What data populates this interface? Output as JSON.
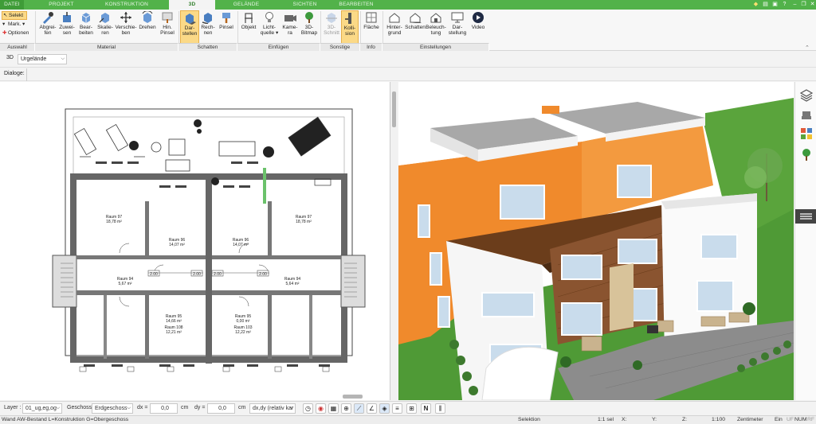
{
  "tabs": [
    "DATEI",
    "PROJEKT",
    "KONSTRUKTION",
    "3D",
    "GELÄNDE",
    "SICHTEN",
    "BEARBEITEN"
  ],
  "ribbon": {
    "auswahl": {
      "select": "Selekt",
      "mark": "Mark.",
      "options": "Optionen"
    },
    "material": [
      [
        "Abgrei-",
        "fen"
      ],
      [
        "Zuwei-",
        "sen"
      ],
      [
        "Bear-",
        "beiten"
      ],
      [
        "Skalie-",
        "ren"
      ],
      [
        "Verschie-",
        "ben"
      ],
      [
        "Drehen",
        ""
      ],
      [
        "Hin.",
        "Pinsel"
      ]
    ],
    "schatten": [
      [
        "Dar-",
        "stellen"
      ],
      [
        "Rech-",
        "nen"
      ],
      [
        "Pinsel",
        ""
      ]
    ],
    "einfuegen": [
      [
        "Objekt",
        ""
      ],
      [
        "Licht-",
        "quelle"
      ],
      [
        "Kame-",
        "ra"
      ],
      [
        "3D-",
        "Bitmap"
      ]
    ],
    "sonstige": [
      [
        "3D-",
        "Schnitt"
      ],
      [
        "Kolli-",
        "sion"
      ]
    ],
    "info": [
      [
        "Fläche",
        ""
      ]
    ],
    "einstellungen": [
      [
        "Hinter-",
        "grund"
      ],
      [
        "Schatten",
        ""
      ],
      [
        "Beleuch-",
        "tung"
      ],
      [
        "Dar-",
        "stellung"
      ],
      [
        "Video",
        ""
      ]
    ]
  },
  "groups": [
    "Auswahl",
    "Material",
    "Schatten",
    "Einfügen",
    "Sonstige",
    "Info",
    "Einstellungen"
  ],
  "toolbar": {
    "view_label": "3D",
    "terrain_select": "Urgelände",
    "dialogs_label": "Dialoge:"
  },
  "plan": {
    "rooms": [
      {
        "name": "Raum 97",
        "area": "18,78 m²"
      },
      {
        "name": "Raum 96",
        "area": "14,07 m²"
      },
      {
        "name": "Raum 96",
        "area": "14,07 m²"
      },
      {
        "name": "Raum 97",
        "area": "18,78 m²"
      },
      {
        "name": "Raum 94",
        "area": "5,67 m²"
      },
      {
        "name": "Raum 94",
        "area": "5,64 m²"
      },
      {
        "name": "Raum 95",
        "area": "14,66 m²"
      },
      {
        "name": "Raum 95",
        "area": "0,00 m²"
      },
      {
        "name": "Raum 108",
        "area": "12,21 m²"
      },
      {
        "name": "Raum 103",
        "area": "12,22 m²"
      }
    ],
    "dims": [
      "2.00",
      "2.00",
      "2.00",
      "2.00"
    ]
  },
  "inputbar": {
    "layer_label": "Layer :",
    "layer_value": "01_ug,eg,og",
    "floor_label": "Geschoss :",
    "floor_value": "Erdgeschoss",
    "dx_label": "dx =",
    "dx_value": "0,0",
    "dx_unit": "cm",
    "dy_label": "dy =",
    "dy_value": "0,0",
    "dy_unit": "cm",
    "mode_value": "dx,dy (relativ kar"
  },
  "status": {
    "left": "Wand AW-Bestand L=Konstruktion G=Obergeschoss",
    "mode": "Selektion",
    "sel": "1:1 sel",
    "x": "X:",
    "y": "Y:",
    "z": "Z:",
    "scale": "1:100",
    "unit": "Zentimeter",
    "ein": "Ein",
    "uf": "UF",
    "num": "NUM",
    "rf": "RF"
  },
  "colors": {
    "accent": "#52b24a",
    "selected": "#fbd987",
    "wall_orange": "#f08a2c"
  }
}
